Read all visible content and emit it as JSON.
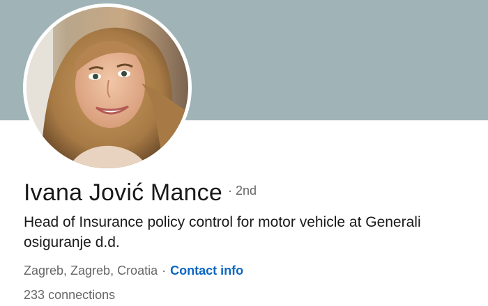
{
  "profile": {
    "name": "Ivana Jović Mance",
    "separator": "·",
    "degree": "2nd",
    "headline": "Head of Insurance policy control for motor vehicle at Generali osiguranje d.d.",
    "location": "Zagreb, Zagreb, Croatia",
    "location_separator": "·",
    "contact_info_label": "Contact info",
    "connections_count": "233",
    "connections_label": "connections"
  },
  "colors": {
    "cover_background": "#a0b4b7",
    "link": "#0a66c2",
    "primary_text": "#191919",
    "secondary_text": "#666666"
  }
}
